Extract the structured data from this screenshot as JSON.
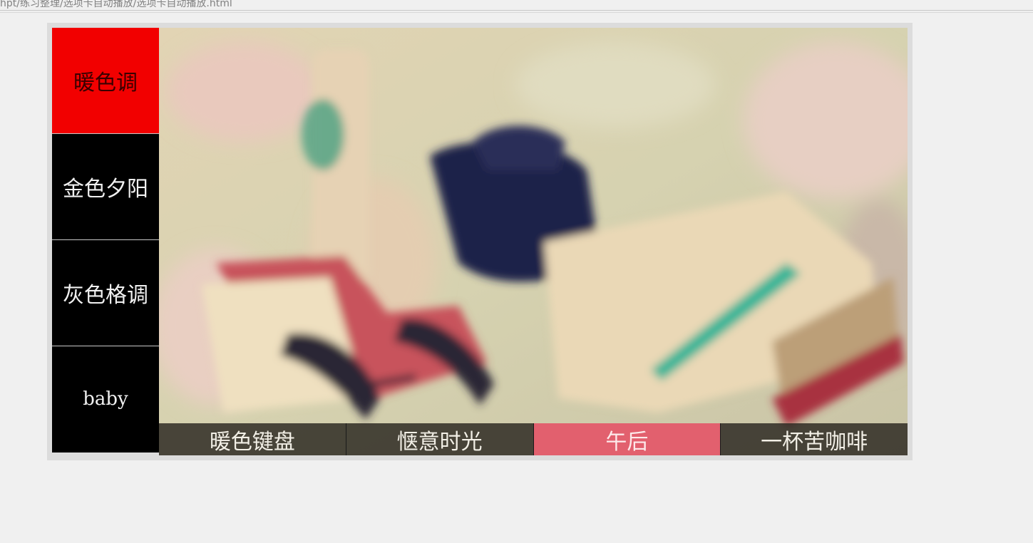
{
  "address_bar": {
    "text": "hpt/练习整理/选项卡自动播放/选项卡自动播放.html"
  },
  "side_tabs": [
    {
      "label": "暖色调",
      "active": true
    },
    {
      "label": "金色夕阳",
      "active": false
    },
    {
      "label": "灰色格调",
      "active": false
    },
    {
      "label": "baby",
      "active": false
    }
  ],
  "captions": [
    {
      "label": "暖色键盘",
      "active": false
    },
    {
      "label": "惬意时光",
      "active": false
    },
    {
      "label": "午后",
      "active": true
    },
    {
      "label": "一杯苦咖啡",
      "active": false
    }
  ],
  "colors": {
    "active_tab": "#f20000",
    "inactive_tab": "#000000",
    "active_caption": "#e2606e",
    "caption_bg": "rgba(40,36,30,0.82)"
  }
}
